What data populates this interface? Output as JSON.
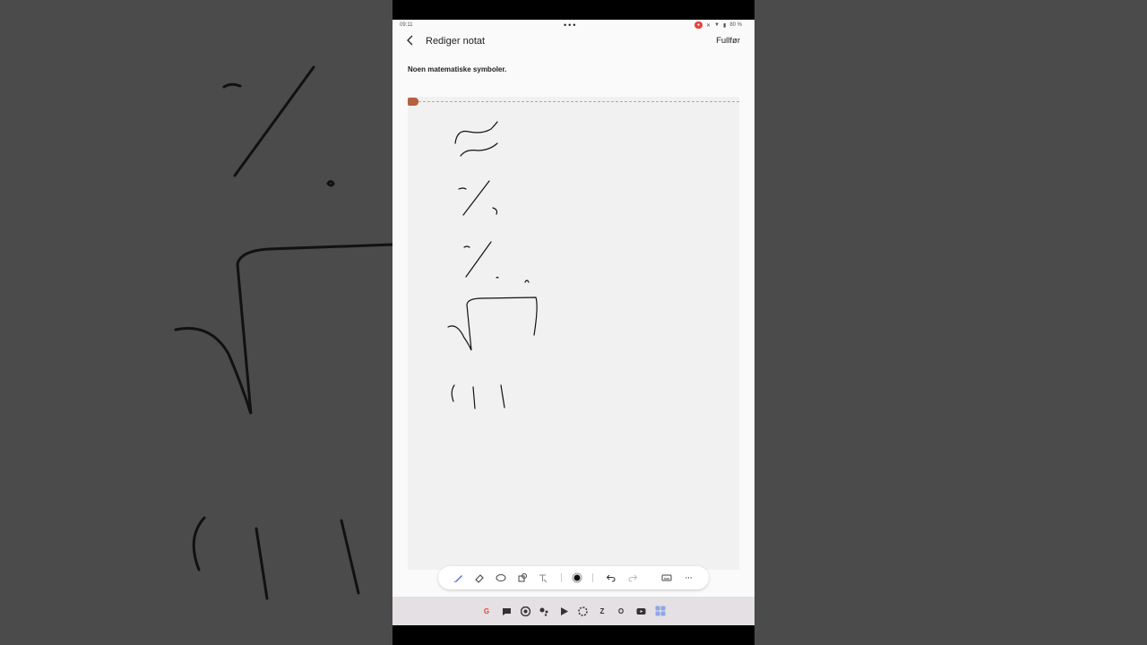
{
  "status_bar": {
    "time": "09:11",
    "battery": "80 %"
  },
  "header": {
    "title": "Rediger notat",
    "done_label": "Fullfør"
  },
  "note": {
    "text": "Noen matematiske symboler."
  },
  "toolbar": {
    "tools": [
      "pen-icon",
      "eraser-icon",
      "lasso-icon",
      "shapes-icon",
      "text-convert-icon",
      "color-picker-icon",
      "undo-icon",
      "redo-icon",
      "keyboard-icon",
      "more-icon"
    ],
    "more_label": "···"
  },
  "dock": {
    "apps": [
      {
        "icon": "google-icon",
        "label": "G"
      },
      {
        "icon": "messages-icon",
        "label": ""
      },
      {
        "icon": "chrome-icon",
        "label": ""
      },
      {
        "icon": "assistant-icon",
        "label": ""
      },
      {
        "icon": "play-store-icon",
        "label": ""
      },
      {
        "icon": "photos-icon",
        "label": ""
      },
      {
        "icon": "zarchiver-icon",
        "label": "Z"
      },
      {
        "icon": "opera-icon",
        "label": "O"
      },
      {
        "icon": "youtube-icon",
        "label": ""
      },
      {
        "icon": "app-drawer-icon",
        "label": ""
      }
    ]
  },
  "colors": {
    "accent": "#b5603f",
    "ink": "#111111",
    "dock_bg": "#e4e0e3",
    "record": "#e0463c"
  }
}
